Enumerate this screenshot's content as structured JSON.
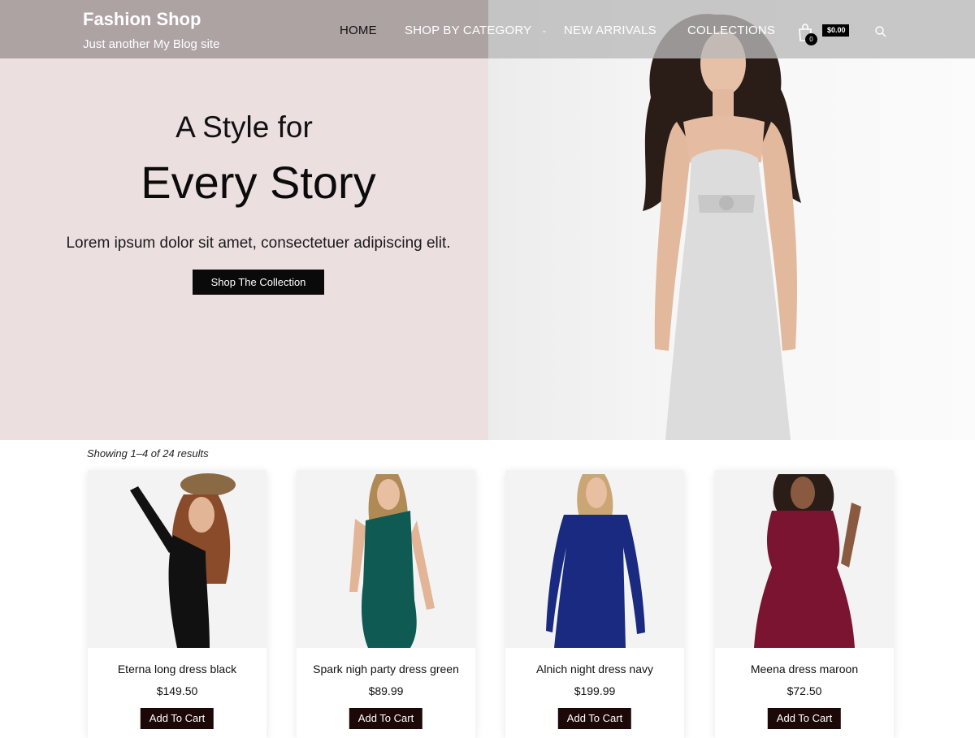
{
  "header": {
    "site_title": "Fashion Shop",
    "tagline": "Just another My Blog site",
    "nav": [
      {
        "label": "HOME",
        "active": true
      },
      {
        "label": "SHOP BY CATEGORY",
        "has_dropdown": true
      },
      {
        "label": "NEW ARRIVALS"
      },
      {
        "label": "COLLECTIONS"
      }
    ],
    "cart_count": "0",
    "cart_total": "$0.00",
    "icons": {
      "cart": "shopping-bag-icon",
      "search": "search-icon",
      "dropdown": "chevron-down-icon"
    }
  },
  "hero": {
    "title_line1": "A Style for",
    "title_line2": "Every Story",
    "subtitle": "Lorem ipsum dolor sit amet, consectetuer adipiscing elit.",
    "button_label": "Shop The Collection",
    "colors": {
      "left_panel": "#ecdfdf",
      "button": "#0a0a0a"
    }
  },
  "shop": {
    "results_text": "Showing 1–4 of 24 results",
    "products": [
      {
        "name": "Eterna long dress black",
        "price": "$149.50",
        "button": "Add To Cart",
        "dress_color": "#111111"
      },
      {
        "name": "Spark nigh party dress green",
        "price": "$89.99",
        "button": "Add To Cart",
        "dress_color": "#0f5a52"
      },
      {
        "name": "Alnich night dress navy",
        "price": "$199.99",
        "button": "Add To Cart",
        "dress_color": "#1a2a80"
      },
      {
        "name": "Meena dress maroon",
        "price": "$72.50",
        "button": "Add To Cart",
        "dress_color": "#7a1430"
      }
    ],
    "button_color": "#1d0808"
  }
}
